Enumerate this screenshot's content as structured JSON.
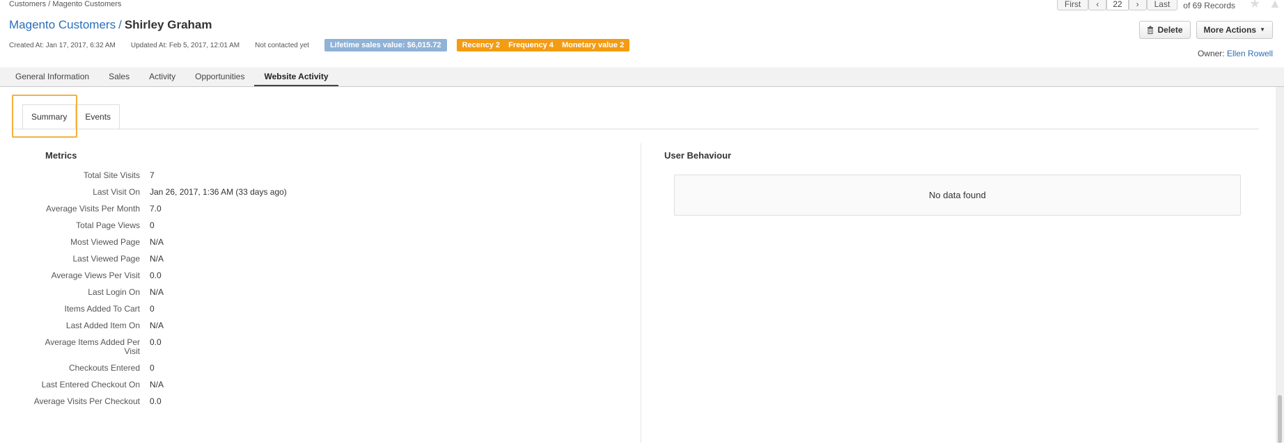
{
  "breadcrumb": "Customers / Magento Customers",
  "pager": {
    "first": "First",
    "prev": "‹",
    "current": "22",
    "next": "›",
    "last": "Last",
    "records": "of 69 Records"
  },
  "title": {
    "entity": "Magento Customers",
    "separator": "/",
    "name": "Shirley Graham"
  },
  "meta": {
    "created": "Created At: Jan 17, 2017, 6:32 AM",
    "updated": "Updated At: Feb 5, 2017, 12:01 AM",
    "contacted": "Not contacted yet",
    "lifetime_badge": "Lifetime sales value: $6,015.72",
    "recency": "Recency 2",
    "frequency": "Frequency 4",
    "monetary": "Monetary value 2"
  },
  "actions": {
    "delete_label": "Delete",
    "more_label": "More Actions"
  },
  "owner": {
    "label": "Owner:",
    "name": "Ellen Rowell"
  },
  "tabs": [
    {
      "label": "General Information"
    },
    {
      "label": "Sales"
    },
    {
      "label": "Activity"
    },
    {
      "label": "Opportunities"
    },
    {
      "label": "Website Activity",
      "active": true
    }
  ],
  "subtabs": [
    {
      "label": "Summary",
      "active": true
    },
    {
      "label": "Events"
    }
  ],
  "metrics": {
    "title": "Metrics",
    "rows": [
      {
        "label": "Total Site Visits",
        "value": "7"
      },
      {
        "label": "Last Visit On",
        "value": "Jan 26, 2017, 1:36 AM (33 days ago)"
      },
      {
        "label": "Average Visits Per Month",
        "value": "7.0"
      },
      {
        "label": "Total Page Views",
        "value": "0"
      },
      {
        "label": "Most Viewed Page",
        "value": "N/A"
      },
      {
        "label": "Last Viewed Page",
        "value": "N/A"
      },
      {
        "label": "Average Views Per Visit",
        "value": "0.0"
      },
      {
        "label": "Last Login On",
        "value": "N/A"
      },
      {
        "label": "Items Added To Cart",
        "value": "0"
      },
      {
        "label": "Last Added Item On",
        "value": "N/A"
      },
      {
        "label": "Average Items Added Per Visit",
        "value": "0.0"
      },
      {
        "label": "Checkouts Entered",
        "value": "0"
      },
      {
        "label": "Last Entered Checkout On",
        "value": "N/A"
      },
      {
        "label": "Average Visits Per Checkout",
        "value": "0.0"
      }
    ]
  },
  "user_behaviour": {
    "title": "User Behaviour",
    "empty": "No data found"
  },
  "colors": {
    "link": "#2a6ebb",
    "badge_blue": "#8fb2d6",
    "badge_orange": "#f39c12",
    "highlight": "#f5b041"
  }
}
